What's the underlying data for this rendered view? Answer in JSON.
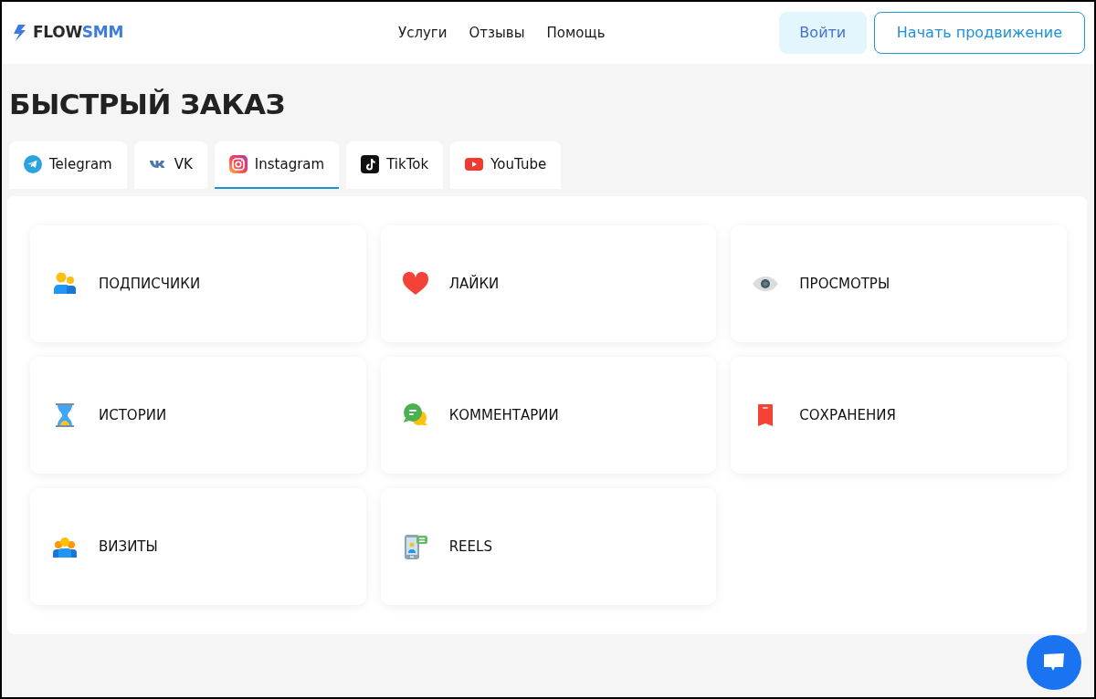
{
  "brand": {
    "parts": [
      "FLOW",
      "SMM"
    ]
  },
  "nav": [
    "Услуги",
    "Отзывы",
    "Помощь"
  ],
  "actions": [
    {
      "label": "Войти",
      "kind": "soft"
    },
    {
      "label": "Начать продвижение",
      "kind": "outline"
    }
  ],
  "heading": "БЫСТРЫЙ ЗАКАЗ",
  "tabs": [
    {
      "label": "Telegram",
      "kind": "telegram",
      "selected": false
    },
    {
      "label": "VK",
      "kind": "vk",
      "selected": false
    },
    {
      "label": "Instagram",
      "kind": "instagram",
      "selected": true
    },
    {
      "label": "TikTok",
      "kind": "tiktok",
      "selected": false
    },
    {
      "label": "YouTube",
      "kind": "youtube",
      "selected": false
    }
  ],
  "services": [
    {
      "label": "ПОДПИСЧИКИ",
      "kind": "followers"
    },
    {
      "label": "ЛАЙКИ",
      "kind": "likes"
    },
    {
      "label": "ПРОСМОТРЫ",
      "kind": "views"
    },
    {
      "label": "ИСТОРИИ",
      "kind": "stories"
    },
    {
      "label": "КОММЕНТАРИИ",
      "kind": "comments"
    },
    {
      "label": "СОХРАНЕНИЯ",
      "kind": "saves"
    },
    {
      "label": "ВИЗИТЫ",
      "kind": "visits"
    },
    {
      "label": "REELS",
      "kind": "reels"
    }
  ]
}
